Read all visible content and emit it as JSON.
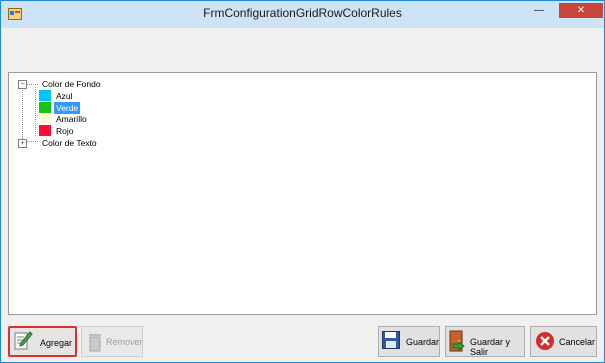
{
  "window": {
    "title": "FrmConfigurationGridRowColorRules",
    "controls": {
      "minimize": "—",
      "maximize": "□",
      "close": "✕"
    }
  },
  "tree": {
    "root_background": "Color de Fondo",
    "root_text": "Color de Texto",
    "items": [
      {
        "label": "Azul",
        "color": "#00c4ff"
      },
      {
        "label": "Verde",
        "color": "#17c50e"
      },
      {
        "label": "Amarillo",
        "color": "#fffbd2"
      },
      {
        "label": "Rojo",
        "color": "#ff0a3b"
      }
    ],
    "selected": "Verde",
    "expanded_toggle": "−",
    "collapsed_toggle": "+"
  },
  "buttons": {
    "add": "Agregar",
    "remove": "Remover",
    "save": "Guardar",
    "save_exit": "Guardar y Salir",
    "cancel": "Cancelar"
  },
  "icons": {
    "app": "app-form-icon",
    "add": "edit-pencil-icon",
    "remove": "trash-icon",
    "save": "floppy-disk-icon",
    "save_exit": "door-exit-icon",
    "cancel": "cancel-x-icon"
  }
}
